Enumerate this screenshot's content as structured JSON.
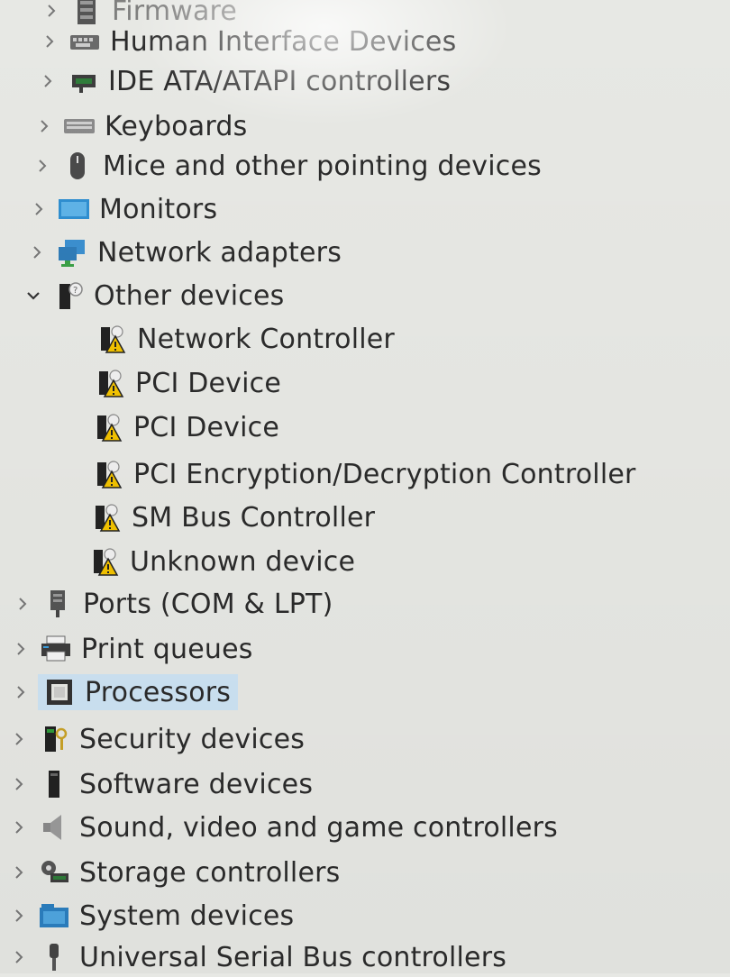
{
  "tree": {
    "items": [
      {
        "label": "Firmware",
        "icon": "firmware-icon",
        "expanded": false
      },
      {
        "label": "Human Interface Devices",
        "icon": "hid-icon",
        "expanded": false
      },
      {
        "label": "IDE ATA/ATAPI controllers",
        "icon": "ide-controller-icon",
        "expanded": false
      },
      {
        "label": "Keyboards",
        "icon": "keyboard-icon",
        "expanded": false
      },
      {
        "label": "Mice and other pointing devices",
        "icon": "mouse-icon",
        "expanded": false
      },
      {
        "label": "Monitors",
        "icon": "monitor-icon",
        "expanded": false
      },
      {
        "label": "Network adapters",
        "icon": "network-adapter-icon",
        "expanded": false
      },
      {
        "label": "Other devices",
        "icon": "other-devices-icon",
        "expanded": true
      },
      {
        "label": "Network Controller",
        "icon": "unknown-device-warning-icon",
        "child": true
      },
      {
        "label": "PCI Device",
        "icon": "unknown-device-warning-icon",
        "child": true
      },
      {
        "label": "PCI Device",
        "icon": "unknown-device-warning-icon",
        "child": true
      },
      {
        "label": "PCI Encryption/Decryption Controller",
        "icon": "unknown-device-warning-icon",
        "child": true
      },
      {
        "label": "SM Bus Controller",
        "icon": "unknown-device-warning-icon",
        "child": true
      },
      {
        "label": "Unknown device",
        "icon": "unknown-device-warning-icon",
        "child": true
      },
      {
        "label": "Ports (COM & LPT)",
        "icon": "port-icon",
        "expanded": false
      },
      {
        "label": "Print queues",
        "icon": "printer-icon",
        "expanded": false
      },
      {
        "label": "Processors",
        "icon": "processor-icon",
        "expanded": false,
        "selected": true
      },
      {
        "label": "Security devices",
        "icon": "security-device-icon",
        "expanded": false
      },
      {
        "label": "Software devices",
        "icon": "software-device-icon",
        "expanded": false
      },
      {
        "label": "Sound, video and game controllers",
        "icon": "speaker-icon",
        "expanded": false
      },
      {
        "label": "Storage controllers",
        "icon": "storage-controller-icon",
        "expanded": false
      },
      {
        "label": "System devices",
        "icon": "system-devices-icon",
        "expanded": false
      },
      {
        "label": "Universal Serial Bus controllers",
        "icon": "usb-icon",
        "expanded": false
      }
    ]
  },
  "colors": {
    "background": "#e7e8e4",
    "selection": "#cde3f3",
    "warning": "#f2c200"
  }
}
